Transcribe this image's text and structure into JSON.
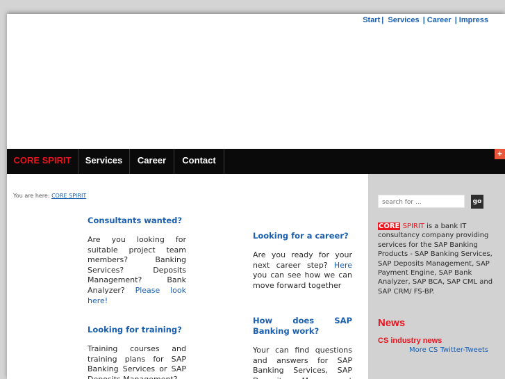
{
  "top_nav": {
    "start": "Start",
    "services": "Services",
    "career": "Career",
    "impress": "Impress",
    "separator": "|"
  },
  "main_menu": {
    "items": [
      "CORE SPIRIT",
      "Services",
      "Career",
      "Contact"
    ],
    "active_color": "#e8131c"
  },
  "expand_button": "+",
  "breadcrumb": {
    "prefix": "You are here:",
    "current": "CORE SPIRIT"
  },
  "content": {
    "consultants": {
      "title": "Consultants wanted?",
      "text": "Are you looking for suitable project team members? Banking Services? Deposits Management? Bank Analyzer?",
      "link": "Please look here!"
    },
    "career": {
      "title": "Looking for a career?",
      "text_before": "Are you ready for your next career step?",
      "link": "Here",
      "text_after": "you can see how we can move forward together"
    },
    "training": {
      "title": "Looking for training?",
      "text": "Training courses and training plans for SAP Banking Services or SAP Deposits Management?"
    },
    "how_work": {
      "title": "How does SAP Banking work?",
      "text": "Your can find questions and answers for SAP Banking Services, SAP Deposits Management and"
    }
  },
  "sidebar": {
    "search_placeholder": "search for ...",
    "go_label": "go",
    "about_core": "CORE",
    "about_spirit": "SPIRIT",
    "about_text": "is a bank IT consultancy company providing services for the SAP Banking Products - SAP Banking Services, SAP Deposits Management, SAP Payment Engine, SAP Bank Analyzer, SAP BCA, SAP CML and SAP CRM/ FS-BP.",
    "news_title": "News",
    "news_link": "CS industry news",
    "tweets_link": "More CS Twitter-Tweets"
  },
  "colors": {
    "link_blue": "#1a5fae",
    "brand_red": "#e8131c",
    "menu_bg": "#0a0a0a",
    "sidebar_bg": "#d2d2d2"
  }
}
